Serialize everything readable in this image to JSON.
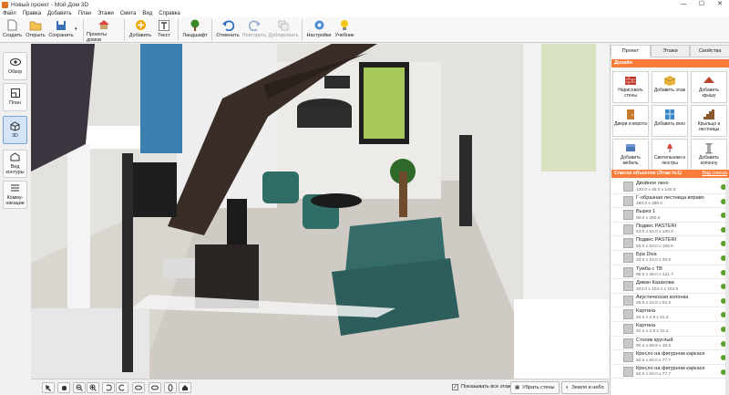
{
  "window": {
    "title": "Новый проект - Мой Дом 3D",
    "controls": [
      "—",
      "☐",
      "✕"
    ]
  },
  "menu": [
    "Файл",
    "Правка",
    "Добавить",
    "План",
    "Этажи",
    "Смета",
    "Вид",
    "Справка"
  ],
  "toolbar": {
    "create": "Создать",
    "open": "Открыть",
    "save": "Сохранить",
    "projects": "Проекты домов",
    "add": "Добавить",
    "text": "Текст",
    "landscape": "Ландшафт",
    "undo": "Отменить",
    "redo": "Повторить",
    "duplicate": "Дублировать",
    "settings": "Настройки",
    "tutorial": "Учебник"
  },
  "leftnav": [
    {
      "label": "Обзор",
      "active": false
    },
    {
      "label": "План",
      "active": false
    },
    {
      "label": "3D",
      "active": true
    },
    {
      "label": "Вид контуры",
      "active": false
    },
    {
      "label": "Комму-никации",
      "active": false
    }
  ],
  "rightpanel": {
    "tabs": [
      "Проект",
      "Этажи",
      "Свойства"
    ],
    "active_tab": "Проект",
    "design_header": "Дизайн",
    "design_buttons": [
      {
        "label": "Нарисовать стены",
        "icon": "walls-icon"
      },
      {
        "label": "Добавить этаж",
        "icon": "floor-icon"
      },
      {
        "label": "Добавить крышу",
        "icon": "roof-icon"
      },
      {
        "label": "Двери и ворота",
        "icon": "door-icon"
      },
      {
        "label": "Добавить окно",
        "icon": "window-icon"
      },
      {
        "label": "Крыльцо и лестницы",
        "icon": "stairs-icon"
      },
      {
        "label": "Добавить мебель",
        "icon": "furniture-icon"
      },
      {
        "label": "Светильники и люстры",
        "icon": "lamp-icon"
      },
      {
        "label": "Добавить колонну",
        "icon": "column-icon"
      }
    ],
    "list_header": "Список объектов (Этаж №1)",
    "list_link": "Вид списка",
    "objects": [
      {
        "name": "Двойное окно",
        "dims": "130.0 x 45.0 x 140.0"
      },
      {
        "name": "Г-образная лестница вправо",
        "dims": "290.0 x 290.0"
      },
      {
        "name": "Вырез 1",
        "dims": "90.0 x 250.0"
      },
      {
        "name": "Подвес PASTERI",
        "dims": "53.0 x 53.0 x 100.0"
      },
      {
        "name": "Подвес PASTERI",
        "dims": "53.0 x 53.0 x 100.0"
      },
      {
        "name": "Бра Diva",
        "dims": "33.0 x 16.0 x 30.0"
      },
      {
        "name": "Тумба с ТВ",
        "dims": "98.0 x 48.0 x 121.7"
      },
      {
        "name": "Диван Казанова",
        "dims": "204.0 x 104.4 x 104.5"
      },
      {
        "name": "Акустическая колонка",
        "dims": "26.0 x 23.0 x 92.0"
      },
      {
        "name": "Картина",
        "dims": "40.4 x 2.9 x 31.2"
      },
      {
        "name": "Картина",
        "dims": "40.4 x 2.9 x 31.2"
      },
      {
        "name": "Столик круглый",
        "dims": "90.2 x 89.9 x 45.0"
      },
      {
        "name": "Кресло на фигурном каркасе",
        "dims": "62.0 x 60.0 x 77.7"
      },
      {
        "name": "Кресло на фигурном каркасе",
        "dims": "62.0 x 60.0 x 77.7"
      }
    ]
  },
  "bottombar": {
    "show_all": "Показывать все этажи",
    "show_all_checked": true,
    "hide_walls": "Убрать стены",
    "earth_sky": "Земля и небо"
  }
}
